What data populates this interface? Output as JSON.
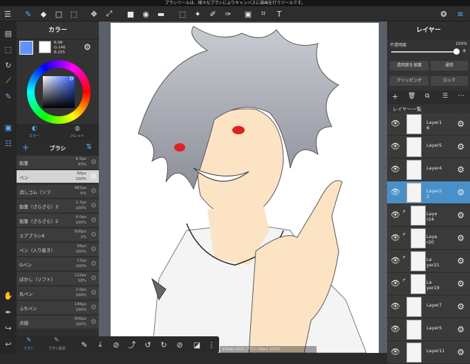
{
  "status_bar": {
    "text": "ブラシツールは、様々なブラシによりキャンバスに描画を行うツールです。"
  },
  "color_panel": {
    "title": "カラー",
    "rgb": {
      "r": "R:98",
      "g": "G:146",
      "b": "B:255"
    },
    "tabs": [
      "カラー",
      "パレット"
    ],
    "fg_color": "#6292ff"
  },
  "brush_panel": {
    "title": "ブラシ",
    "items": [
      {
        "name": "鉛筆",
        "size": "6.5px",
        "opacity": "93%"
      },
      {
        "name": "ペン",
        "size": "60px",
        "opacity": "100%"
      },
      {
        "name": "消しゴム（ソフ",
        "size": "487px",
        "opacity": "5%"
      },
      {
        "name": "鉛筆（ざらざら）3",
        "size": "1.7px",
        "opacity": "100%"
      },
      {
        "name": "鉛筆（ざらざら）2",
        "size": "4.0px",
        "opacity": "100%"
      },
      {
        "name": "エアブラシ6",
        "size": "500px",
        "opacity": "1%"
      },
      {
        "name": "ペン（入り抜き）",
        "size": "56px",
        "opacity": "100%"
      },
      {
        "name": "Gペン",
        "size": "17px",
        "opacity": "100%"
      },
      {
        "name": "ぼかし（ソフト）",
        "size": "122px",
        "opacity": "18%"
      },
      {
        "name": "丸ペン",
        "size": "2.0px",
        "opacity": "100%"
      },
      {
        "name": "ふちペン",
        "size": "146px",
        "opacity": "100%"
      },
      {
        "name": "点描",
        "size": "500px",
        "opacity": "100%"
      }
    ],
    "bottom_tabs": [
      "ブラシ",
      "ブラシ設定"
    ]
  },
  "layer_panel": {
    "title": "レイヤー",
    "opacity_label": "不透明度",
    "opacity_value": "100%",
    "protect_alpha": "透明度を保護",
    "blend_mode": "通常",
    "clipping": "クリッピング",
    "lock": "ロック",
    "list_title": "レイヤー一覧",
    "layers": [
      {
        "name": "Layer1\n8"
      },
      {
        "name": "Layer5"
      },
      {
        "name": "Layer4"
      },
      {
        "name": "Layer2\n2"
      },
      {
        "name": "Laye\nr24"
      },
      {
        "name": "Laye\nr20"
      },
      {
        "name": "La\nyer21"
      },
      {
        "name": "La\nyer19"
      },
      {
        "name": "Layer7"
      },
      {
        "name": "Layer5"
      },
      {
        "name": "Layer11"
      }
    ]
  },
  "info_bar": {
    "text": "350dpi 80% ブラシ:60px 100%"
  }
}
